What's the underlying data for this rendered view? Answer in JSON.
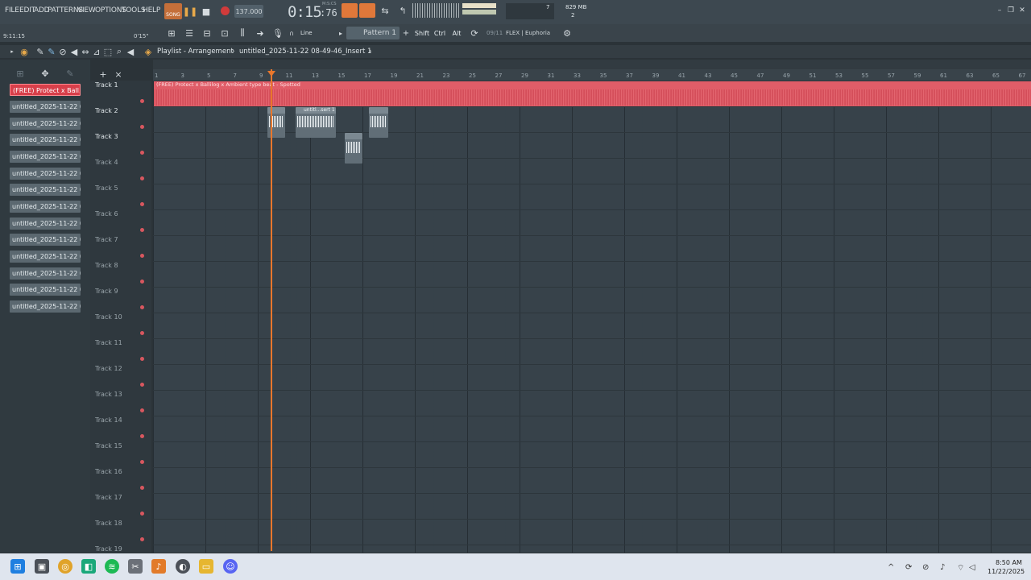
{
  "menu": [
    "FILE",
    "EDIT",
    "ADD",
    "PATTERNS",
    "VIEW",
    "OPTIONS",
    "TOOLS",
    "HELP"
  ],
  "transport": {
    "mode_label": "SONG",
    "tempo": "137.000",
    "time_main": "0:15",
    "time_sub": ":76",
    "time_unit": "M:S:CS",
    "cpu_num": "7",
    "mem": "829 MB",
    "mem_sub": "2"
  },
  "hint": {
    "position": "9:11:15",
    "right": "0'15\""
  },
  "toolbar2": {
    "snap": "Line",
    "pattern": "Pattern 1",
    "shift": "Shift",
    "ctrl": "Ctrl",
    "alt": "Alt",
    "preset_count": "09/11",
    "preset_name": "FLEX | Euphoria"
  },
  "playlist": {
    "title": "Playlist - Arrangement",
    "sep": "›",
    "insert": "untitled_2025-11-22 08-49-46_Insert 1",
    "end": "›"
  },
  "picker": [
    "(FREE) Protect x Ball...",
    "untitled_2025-11-22 08-...",
    "untitled_2025-11-22 08-...",
    "untitled_2025-11-22 08-...",
    "untitled_2025-11-22 08-...",
    "untitled_2025-11-22 08-...",
    "untitled_2025-11-22 08-...",
    "untitled_2025-11-22 08-...",
    "untitled_2025-11-22 08-...",
    "untitled_2025-11-22 08-...",
    "untitled_2025-11-22 08-...",
    "untitled_2025-11-22 08-...",
    "untitled_2025-11-22 08-...",
    "untitled_2025-11-22 08-..."
  ],
  "tracks": [
    "Track 1",
    "Track 2",
    "Track 3",
    "Track 4",
    "Track 5",
    "Track 6",
    "Track 7",
    "Track 8",
    "Track 9",
    "Track 10",
    "Track 11",
    "Track 12",
    "Track 13",
    "Track 14",
    "Track 15",
    "Track 16",
    "Track 17",
    "Track 18",
    "Track 19"
  ],
  "ruler": [
    "1",
    "3",
    "5",
    "7",
    "9",
    "11",
    "13",
    "15",
    "17",
    "19",
    "21",
    "23",
    "25",
    "27",
    "29",
    "31",
    "33",
    "35",
    "37",
    "39",
    "41",
    "43",
    "45",
    "47",
    "49",
    "51",
    "53",
    "55",
    "57",
    "59",
    "61",
    "63",
    "65",
    "67"
  ],
  "clips": {
    "main": "(FREE) Protect x Ballilog x Ambient type beat - Spotted",
    "small": "untitl...sert 1"
  },
  "clock": {
    "time": "8:50 AM",
    "date": "11/22/2025"
  },
  "colors": {
    "accent": "#e8772c",
    "clip": "#e05d68",
    "picker_active": "#d83f4a"
  }
}
